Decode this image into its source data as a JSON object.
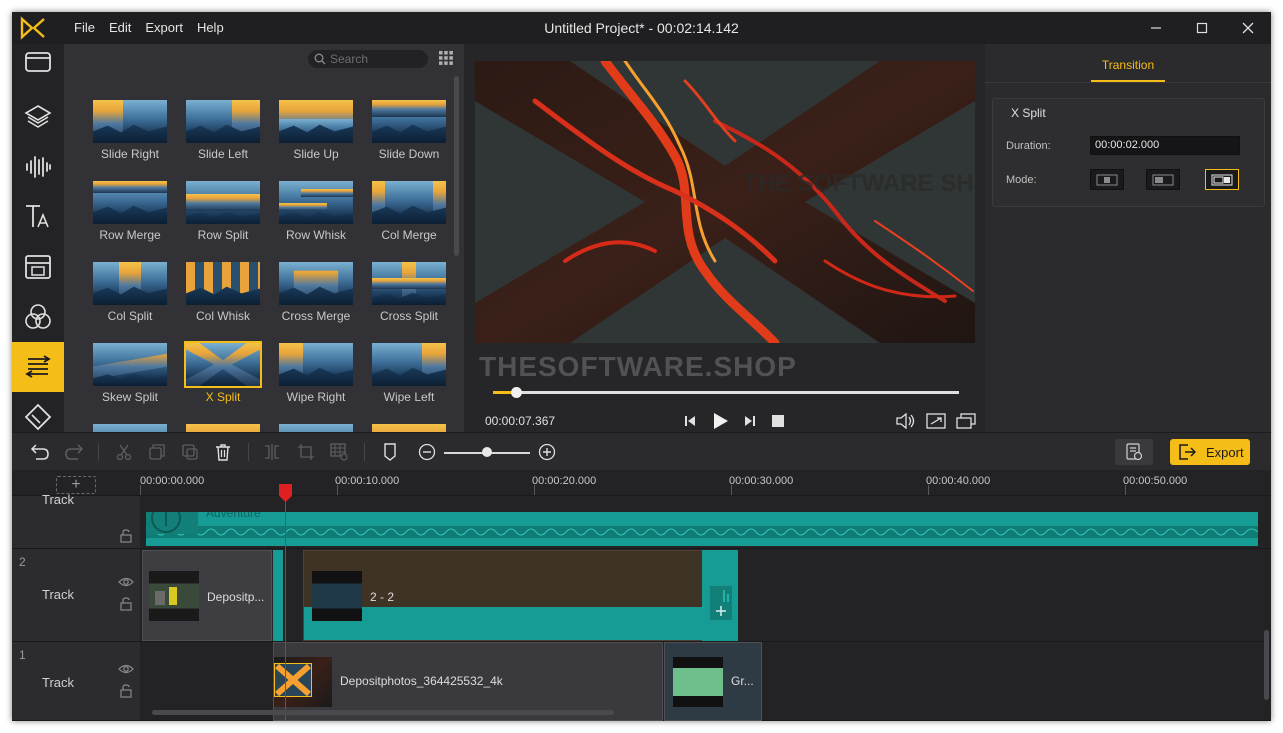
{
  "window": {
    "title": "Untitled Project* - 00:02:14.142",
    "menu": [
      "File",
      "Edit",
      "Export",
      "Help"
    ],
    "controls": [
      "minimize-icon",
      "maximize-icon",
      "close-icon"
    ]
  },
  "sidebar": {
    "items": [
      {
        "name": "media",
        "icon": "folder-icon"
      },
      {
        "name": "layers",
        "icon": "layers-icon"
      },
      {
        "name": "audio",
        "icon": "waveform-icon"
      },
      {
        "name": "text",
        "icon": "text-icon"
      },
      {
        "name": "templates",
        "icon": "template-icon"
      },
      {
        "name": "filters",
        "icon": "circles-icon"
      },
      {
        "name": "transitions",
        "icon": "transition-icon",
        "active": true
      },
      {
        "name": "elements",
        "icon": "sticker-icon"
      }
    ]
  },
  "library": {
    "search_placeholder": "Search",
    "transitions": [
      {
        "label": "Slide Right"
      },
      {
        "label": "Slide Left"
      },
      {
        "label": "Slide Up"
      },
      {
        "label": "Slide Down"
      },
      {
        "label": "Row Merge"
      },
      {
        "label": "Row Split"
      },
      {
        "label": "Row Whisk"
      },
      {
        "label": "Col Merge"
      },
      {
        "label": "Col Split"
      },
      {
        "label": "Col Whisk"
      },
      {
        "label": "Cross Merge"
      },
      {
        "label": "Cross Split"
      },
      {
        "label": "Skew Split"
      },
      {
        "label": "X Split",
        "selected": true
      },
      {
        "label": "Wipe Right"
      },
      {
        "label": "Wipe Left"
      },
      {
        "label": ""
      },
      {
        "label": ""
      },
      {
        "label": ""
      },
      {
        "label": ""
      }
    ]
  },
  "preview": {
    "video_watermark": "THE SOFTWARE SH",
    "overlay_watermark": "THESOFTWARE.SHOP",
    "timecode": "00:00:07.367",
    "progress": 0.05
  },
  "properties": {
    "tab": "Transition",
    "section": "X Split",
    "duration_label": "Duration:",
    "duration_value": "00:00:02.000",
    "mode_label": "Mode:",
    "selected_mode": 3
  },
  "toolbar": {
    "export_label": "Export",
    "zoom_level": 0.5
  },
  "timeline": {
    "ruler": [
      "00:00:00.000",
      "00:00:10.000",
      "00:00:20.000",
      "00:00:30.000",
      "00:00:40.000",
      "00:00:50.000"
    ],
    "tracks": [
      {
        "number": "",
        "name": "Track",
        "clips": [
          {
            "label": "Adventure",
            "type": "audio"
          }
        ]
      },
      {
        "number": "2",
        "name": "Track",
        "clips": [
          {
            "label": "Depositp...",
            "type": "video"
          },
          {
            "label": "2 - 2",
            "type": "video"
          }
        ]
      },
      {
        "number": "1",
        "name": "Track",
        "clips": [
          {
            "label": "Depositphotos_364425532_4k",
            "type": "video"
          },
          {
            "label": "Gr...",
            "type": "video"
          }
        ]
      }
    ],
    "accent": "#f5bd18",
    "audio_color": "#16a09a",
    "playhead_color": "#e02020"
  }
}
